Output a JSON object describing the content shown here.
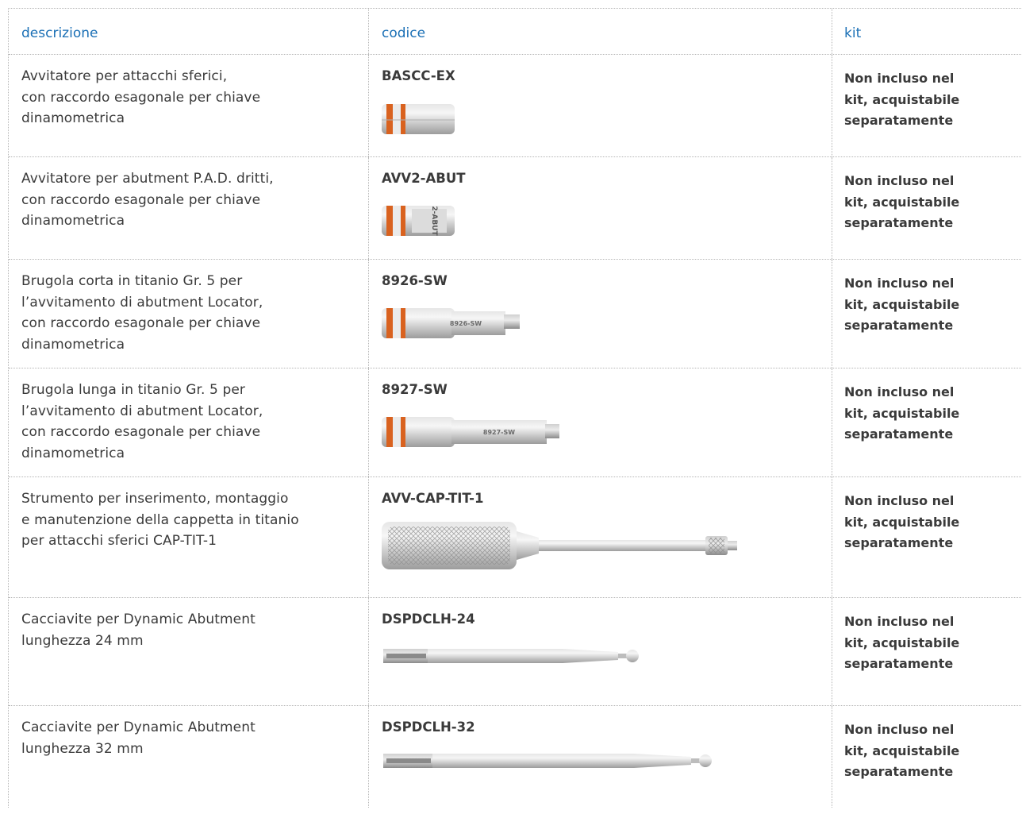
{
  "header": {
    "col_descrizione": "descrizione",
    "col_codice": "codice",
    "col_kit": "kit"
  },
  "colors": {
    "header_text": "#1a6fb5",
    "body_text": "#3a3a3a",
    "grid_lines": "#b5b5b5",
    "o_ring": "#d9621f"
  },
  "rows": [
    {
      "description": [
        "Avvitatore per attacchi sferici,",
        "con raccordo esagonale per chiave",
        "dinamometrica"
      ],
      "code": "BASCC-EX",
      "kit": [
        "Non incluso nel",
        "kit, acquistabile",
        "separatamente"
      ],
      "image": "ball-attachment-screwdriver-image"
    },
    {
      "description": [
        "Avvitatore per abutment P.A.D. dritti,",
        "con raccordo esagonale per chiave",
        "dinamometrica"
      ],
      "code": "AVV2-ABUT",
      "kit": [
        "Non incluso nel",
        "kit, acquistabile",
        "separatamente"
      ],
      "image_label": "2-ABUT",
      "image": "pad-abutment-screwdriver-image"
    },
    {
      "description": [
        "Brugola corta in titanio Gr. 5 per",
        "l’avvitamento di abutment Locator,",
        "con raccordo esagonale per chiave",
        "dinamometrica"
      ],
      "code": "8926-SW",
      "kit": [
        "Non incluso nel",
        "kit, acquistabile",
        "separatamente"
      ],
      "image_label": "8926-SW",
      "image": "short-hex-key-image"
    },
    {
      "description": [
        "Brugola lunga in titanio Gr. 5 per",
        "l’avvitamento di abutment Locator,",
        "con raccordo esagonale per chiave",
        "dinamometrica"
      ],
      "code": "8927-SW",
      "kit": [
        "Non incluso nel",
        "kit, acquistabile",
        "separatamente"
      ],
      "image_label": "8927-SW",
      "image": "long-hex-key-image"
    },
    {
      "description": [
        "Strumento per inserimento, montaggio",
        "e manutenzione della cappetta in titanio",
        "per attacchi sferici CAP-TIT-1"
      ],
      "code": "AVV-CAP-TIT-1",
      "kit": [
        "Non incluso nel",
        "kit, acquistabile",
        "separatamente"
      ],
      "image": "cap-insertion-tool-image"
    },
    {
      "description": [
        "Cacciavite per Dynamic Abutment",
        "lunghezza 24 mm"
      ],
      "code": "DSPDCLH-24",
      "kit": [
        "Non incluso nel",
        "kit, acquistabile",
        "separatamente"
      ],
      "image": "dynamic-abutment-driver-24-image"
    },
    {
      "description": [
        "Cacciavite per Dynamic Abutment",
        "lunghezza 32 mm"
      ],
      "code": "DSPDCLH-32",
      "kit": [
        "Non incluso nel",
        "kit, acquistabile",
        "separatamente"
      ],
      "image": "dynamic-abutment-driver-32-image"
    }
  ]
}
